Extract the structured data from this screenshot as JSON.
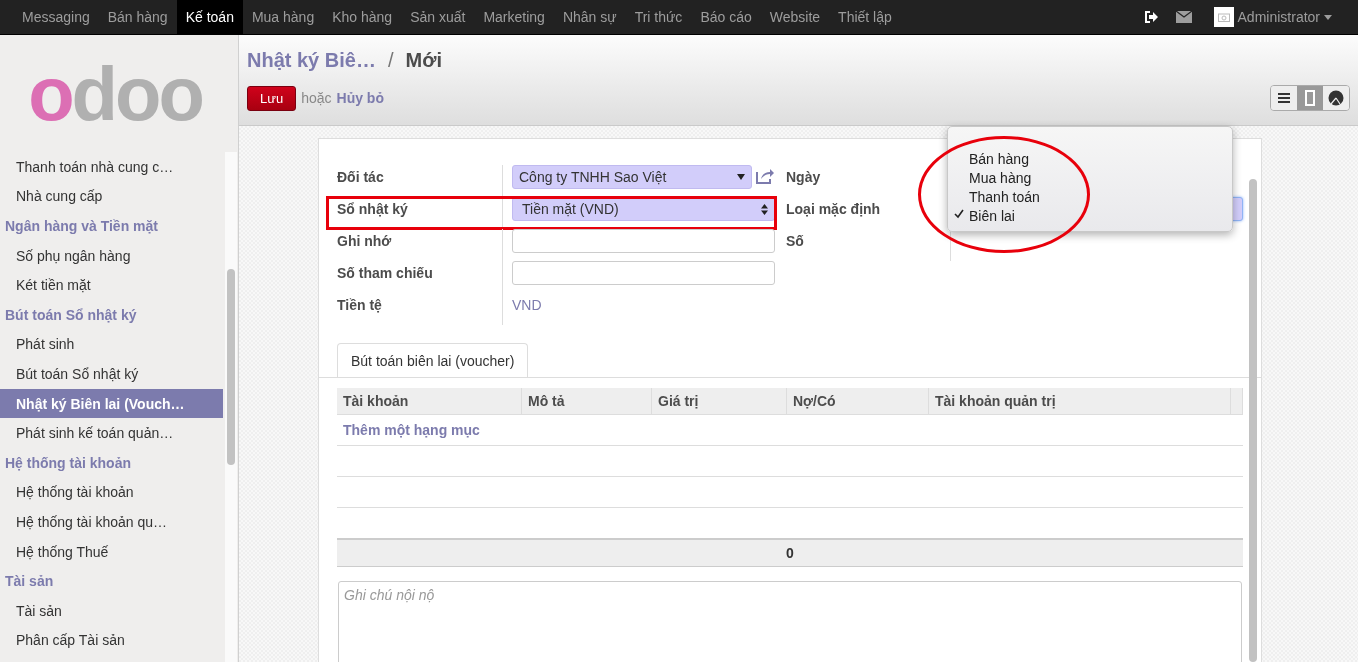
{
  "top_menu": {
    "items": [
      {
        "label": "Messaging",
        "selected": false
      },
      {
        "label": "Bán hàng",
        "selected": false
      },
      {
        "label": "Kế toán",
        "selected": true
      },
      {
        "label": "Mua hàng",
        "selected": false
      },
      {
        "label": "Kho hàng",
        "selected": false
      },
      {
        "label": "Sản xuất",
        "selected": false
      },
      {
        "label": "Marketing",
        "selected": false
      },
      {
        "label": "Nhân sự",
        "selected": false
      },
      {
        "label": "Tri thức",
        "selected": false
      },
      {
        "label": "Báo cáo",
        "selected": false
      },
      {
        "label": "Website",
        "selected": false
      },
      {
        "label": "Thiết lập",
        "selected": false
      }
    ],
    "user": "Administrator"
  },
  "sidebar": {
    "logo": "odoo",
    "groups": [
      {
        "items": [
          {
            "label": "Thanh toán nhà cung c…",
            "selected": false
          },
          {
            "label": "Nhà cung cấp",
            "selected": false
          }
        ]
      },
      {
        "heading": "Ngân hàng và Tiền mặt",
        "items": [
          {
            "label": "Số phụ ngân hàng",
            "selected": false
          },
          {
            "label": "Két tiền mặt",
            "selected": false
          }
        ]
      },
      {
        "heading": "Bút toán Sổ nhật ký",
        "items": [
          {
            "label": "Phát sinh",
            "selected": false
          },
          {
            "label": "Bút toán Sổ nhật ký",
            "selected": false
          },
          {
            "label": "Nhật ký Biên lai (Vouch…",
            "selected": true
          },
          {
            "label": "Phát sinh kế toán quản…",
            "selected": false
          }
        ]
      },
      {
        "heading": "Hệ thống tài khoản",
        "items": [
          {
            "label": "Hệ thống tài khoản",
            "selected": false
          },
          {
            "label": "Hệ thống tài khoản qu…",
            "selected": false
          },
          {
            "label": "Hệ thống Thuế",
            "selected": false
          }
        ]
      },
      {
        "heading": "Tài sản",
        "items": [
          {
            "label": "Tài sản",
            "selected": false
          },
          {
            "label": "Phân cấp Tài sản",
            "selected": false
          }
        ]
      }
    ]
  },
  "breadcrumb": {
    "parent": "Nhật ký Biê…",
    "separator": "/",
    "current": "Mới"
  },
  "actions": {
    "save": "Lưu",
    "or": "hoặc",
    "discard": "Hủy bỏ"
  },
  "view_switcher": [
    {
      "kind": "list",
      "selected": false
    },
    {
      "kind": "form",
      "selected": true
    },
    {
      "kind": "graph",
      "selected": false
    }
  ],
  "form": {
    "left_fields": [
      {
        "label": "Đối tác",
        "kind": "many2one",
        "value": "Công ty TNHH Sao Việt",
        "highlighted": false
      },
      {
        "label": "Sổ nhật ký",
        "kind": "select",
        "value": "Tiền mặt (VND)",
        "highlighted": true
      },
      {
        "label": "Ghi nhớ",
        "kind": "input",
        "highlighted": false
      },
      {
        "label": "Số tham chiếu",
        "kind": "input",
        "highlighted": false
      },
      {
        "label": "Tiền tệ",
        "kind": "readonly",
        "value": "VND",
        "highlighted": false
      }
    ],
    "right_fields": [
      {
        "label": "Ngày",
        "kind": "hidden"
      },
      {
        "label": "Loại mặc định",
        "kind": "select"
      },
      {
        "label": "Số",
        "kind": "readonly"
      }
    ],
    "dropdown": {
      "circled": true,
      "options": [
        {
          "label": "Bán hàng",
          "selected": false
        },
        {
          "label": "Mua hàng",
          "selected": false
        },
        {
          "label": "Thanh toán",
          "selected": false
        },
        {
          "label": "Biên lai",
          "selected": true
        }
      ]
    },
    "tabs": [
      {
        "label": "Bút toán biên lai (voucher)",
        "selected": true
      }
    ],
    "table": {
      "columns": [
        "Tài khoản",
        "Mô tả",
        "Giá trị",
        "Nợ/Có",
        "Tài khoản quản trị"
      ],
      "add_line": "Thêm một hạng mục",
      "total": "0"
    },
    "notes": {
      "placeholder": "Ghi chú nội nộ"
    }
  }
}
